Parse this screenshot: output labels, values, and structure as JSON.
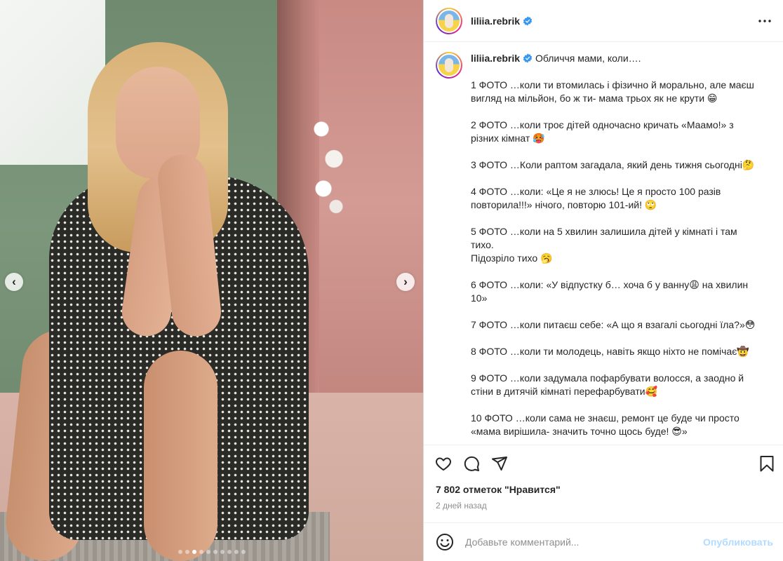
{
  "post": {
    "username": "liliia.rebrik",
    "verified": true,
    "more_icon": "more-horizontal-icon"
  },
  "media": {
    "prev_glyph": "‹",
    "next_glyph": "›",
    "slide_count": 10,
    "active_slide": 3
  },
  "caption": {
    "username": "liliia.rebrik",
    "intro": "Обличчя мами, коли….",
    "paragraphs": [
      "1 ФОТО …коли ти втомилась і фізично й морально, але маєш вигляд на мільйон, бо ж ти- мама трьох як не крути 😁",
      "2 ФОТО …коли троє дітей одночасно кричать «Маамо!» з різних кімнат 🥵",
      "3 ФОТО …Коли раптом загадала, який день тижня сьогодні🤔",
      "4 ФОТО …коли: «Це я не злюсь! Це я просто 100 разів повторила!!!» нічого, повторю 101-ий! 🙄",
      "5 ФОТО …коли на 5 хвилин залишила дітей у кімнаті і там тихо.\nПідозріло тихо 🥱",
      "6 ФОТО …коли: «У відпустку б… хоча б у ванну😩  на хвилин 10»",
      "7 ФОТО …коли питаєш себе: «А що я взагалі сьогодні їла?»😳",
      "8 ФОТО …коли ти молодець, навіть якщо ніхто не помічає🤠",
      "9 ФОТО …коли задумала пофарбувати волосся, а заодно й стіни в дитячій кімнаті перефарбувати🥰",
      "10 ФОТО …коли сама не знаєш, ремонт це буде чи просто «мама вирішила- значить точно щось буде! 😎»"
    ]
  },
  "actions": {
    "like_icon": "heart-icon",
    "comment_icon": "comment-icon",
    "share_icon": "share-icon",
    "save_icon": "bookmark-icon"
  },
  "stats": {
    "likes_text": "7 802 отметок \"Нравится\"",
    "time_text": "2 дней назад"
  },
  "comment_box": {
    "placeholder": "Добавьте комментарий...",
    "publish_label": "Опубликовать",
    "emoji_icon": "emoji-icon"
  },
  "colors": {
    "verified": "#3897f0",
    "publish_disabled": "#b3dbff",
    "secondary_text": "#8e8e8e"
  }
}
